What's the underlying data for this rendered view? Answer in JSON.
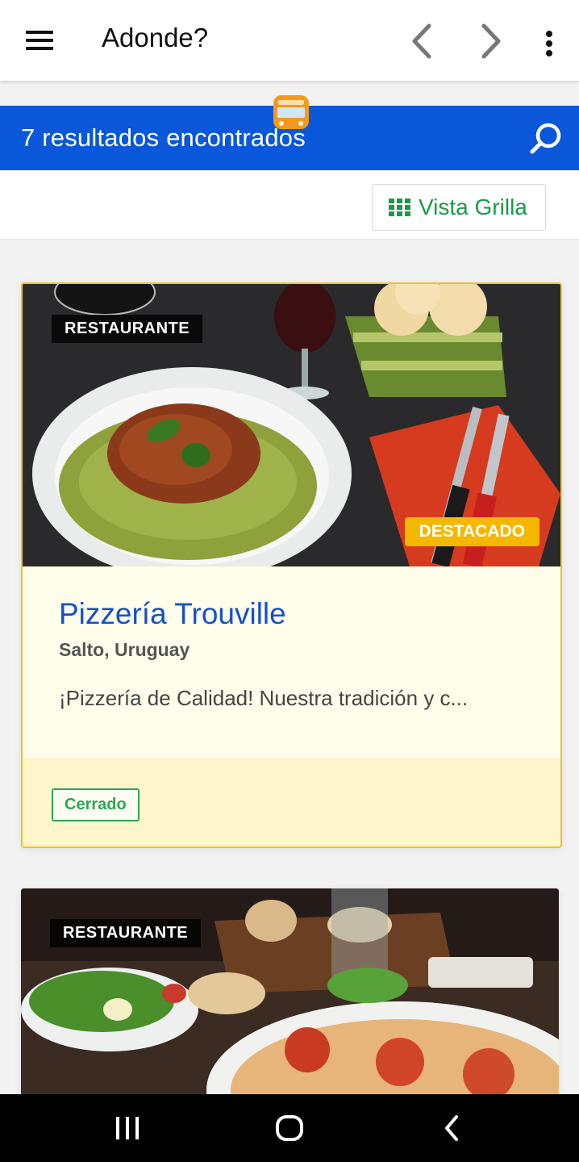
{
  "appbar": {
    "title": "Adonde?",
    "icons": [
      "menu-icon",
      "back-arrow-icon",
      "forward-arrow-icon",
      "more-vert-icon"
    ]
  },
  "results": {
    "count_text": "7 resultados encontrados",
    "accent": "#0b57d9"
  },
  "view_toggle": {
    "label": "Vista Grilla",
    "color": "#1a9a47"
  },
  "listings": [
    {
      "category": "RESTAURANTE",
      "featured_label": "DESTACADO",
      "name": "Pizzería Trouville",
      "location": "Salto, Uruguay",
      "description": "¡Pizzería de Calidad! Nuestra tradición y c...",
      "status": "Cerrado",
      "image": "pasta-dish-photo"
    },
    {
      "category": "RESTAURANTE",
      "image": "pizza-salad-photo"
    }
  ],
  "system_nav": {
    "icons": [
      "recent-apps-icon",
      "home-icon",
      "back-icon"
    ]
  }
}
